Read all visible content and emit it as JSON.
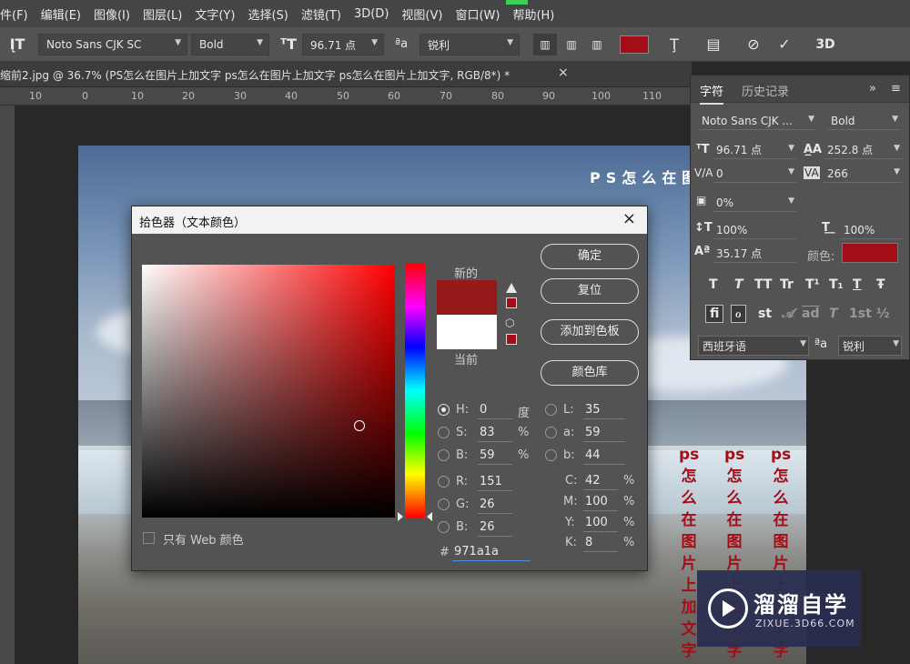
{
  "menu": [
    "件(F)",
    "编辑(E)",
    "图像(I)",
    "图层(L)",
    "文字(Y)",
    "选择(S)",
    "滤镜(T)",
    "3D(D)",
    "视图(V)",
    "窗口(W)",
    "帮助(H)"
  ],
  "options": {
    "font_family": "Noto Sans CJK SC",
    "font_style": "Bold",
    "font_size": "96.71 点",
    "aa_icon": "ªa",
    "antialias": "锐利",
    "text_color": "#a30d17",
    "cancel_icon": "⊘",
    "commit_icon": "✓",
    "three_d": "3D"
  },
  "document": {
    "tab_title": "缩前2.jpg @ 36.7% (PS怎么在图片上加文字 ps怎么在图片上加文字 ps怎么在图片上加文字, RGB/8*) *",
    "close": "×",
    "ruler_ticks": [
      "10",
      "0",
      "10",
      "20",
      "30",
      "40",
      "50",
      "60",
      "70",
      "80",
      "90",
      "100",
      "110"
    ]
  },
  "canvas": {
    "headline": "PS怎么在图",
    "vertical_columns": [
      "ps怎么在图片上加文字",
      "ps怎么在图片上加文字",
      "ps怎么在图片上加文字"
    ]
  },
  "watermark": {
    "brand": "溜溜自学",
    "url": "ZIXUE.3D66.COM"
  },
  "char_panel": {
    "tabs": [
      "字符",
      "历史记录"
    ],
    "menu_glyph": "≡",
    "collapse_glyph": "»",
    "font_family": "Noto Sans CJK ...",
    "font_style": "Bold",
    "size": "96.71 点",
    "leading": "252.8 点",
    "kerning": "0",
    "tracking": "266",
    "tsume": "0%",
    "vscale": "100%",
    "hscale": "100%",
    "baseline": "35.17 点",
    "color_label": "颜色:",
    "color": "#a30d17",
    "style_glyphs": [
      "T",
      "T",
      "TT",
      "Tr",
      "T¹",
      "T₁",
      "T",
      "Ŧ"
    ],
    "ot_glyphs": [
      "fi",
      "ℴ",
      "st",
      "𝒜",
      "ad",
      "T",
      "1st",
      "½"
    ],
    "language": "西班牙语",
    "aa_icon": "ªa",
    "antialias": "锐利"
  },
  "dialog": {
    "title": "拾色器（文本颜色）",
    "close": "×",
    "new_label": "新的",
    "current_label": "当前",
    "new_color": "#971a1a",
    "current_color": "#ffffff",
    "buttons": [
      "确定",
      "复位",
      "添加到色板",
      "颜色库"
    ],
    "fields": {
      "H": {
        "label": "H:",
        "value": "0",
        "unit": "度"
      },
      "S": {
        "label": "S:",
        "value": "83",
        "unit": "%"
      },
      "Bv": {
        "label": "B:",
        "value": "59",
        "unit": "%"
      },
      "R": {
        "label": "R:",
        "value": "151"
      },
      "G": {
        "label": "G:",
        "value": "26"
      },
      "B": {
        "label": "B:",
        "value": "26"
      },
      "L": {
        "label": "L:",
        "value": "35"
      },
      "a": {
        "label": "a:",
        "value": "59"
      },
      "b": {
        "label": "b:",
        "value": "44"
      },
      "C": {
        "label": "C:",
        "value": "42",
        "unit": "%"
      },
      "M": {
        "label": "M:",
        "value": "100",
        "unit": "%"
      },
      "Y": {
        "label": "Y:",
        "value": "100",
        "unit": "%"
      },
      "K": {
        "label": "K:",
        "value": "8",
        "unit": "%"
      }
    },
    "hex_label": "#",
    "hex": "971a1a",
    "web_only": "只有 Web 颜色"
  }
}
